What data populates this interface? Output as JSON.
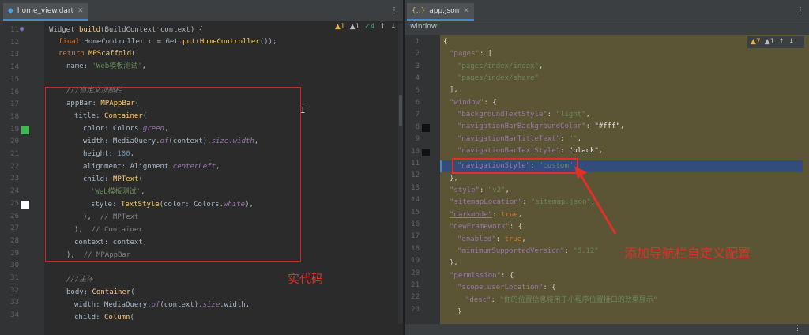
{
  "left": {
    "tab": "home_view.dart",
    "inspection": {
      "warn": "1",
      "weak": "1",
      "typo": "4"
    },
    "lines": [
      "11",
      "12",
      "13",
      "14",
      "15",
      "16",
      "17",
      "18",
      "19",
      "20",
      "21",
      "22",
      "23",
      "24",
      "25",
      "26",
      "27",
      "28",
      "29",
      "30",
      "31",
      "32",
      "33",
      "34"
    ],
    "code": {
      "l11a": "Widget ",
      "l11b": "build",
      "l11c": "(BuildContext context) {",
      "l12a": "final ",
      "l12b": "HomeController c = Get.",
      "l12c": "put",
      "l12d": "(",
      "l12e": "HomeController",
      "l12f": "());",
      "l13a": "return ",
      "l13b": "MPScaffold",
      "l13c": "(",
      "l14a": "name: ",
      "l14b": "'Web模板测试'",
      "l14c": ",",
      "l16": "///自定义顶部栏",
      "l17a": "appBar: ",
      "l17b": "MPAppBar",
      "l17c": "(",
      "l18a": "title: ",
      "l18b": "Container",
      "l18c": "(",
      "l19a": "color: Colors.",
      "l19b": "green",
      "l19c": ",",
      "l20a": "width: MediaQuery.",
      "l20b": "of",
      "l20c": "(context).",
      "l20d": "size",
      "l20e": ".",
      "l20f": "width",
      "l20g": ",",
      "l21a": "height: ",
      "l21b": "100",
      "l21c": ",",
      "l22a": "alignment: Alignment.",
      "l22b": "centerLeft",
      "l22c": ",",
      "l23a": "child: ",
      "l23b": "MPText",
      "l23c": "(",
      "l24a": "'Web模板测试'",
      "l24b": ",",
      "l25a": "style: ",
      "l25b": "TextStyle",
      "l25c": "(color: Colors.",
      "l25d": "white",
      "l25e": "),",
      "l26a": "),  ",
      "l26b": "// MPText",
      "l27a": "),  ",
      "l27b": "// Container",
      "l28": "context: context,",
      "l29a": "),  ",
      "l29b": "// MPAppBar",
      "l31": "///主体",
      "l32a": "body: ",
      "l32b": "Container",
      "l32c": "(",
      "l33a": "width: MediaQuery.",
      "l33b": "of",
      "l33c": "(context).",
      "l33d": "size",
      "l33e": ".width,",
      "l34a": "child: ",
      "l34b": "Column",
      "l34c": "("
    },
    "annotation": "实代码"
  },
  "right": {
    "tab": "app.json",
    "tool_window": "window",
    "inspection": {
      "warn": "7",
      "weak": "1"
    },
    "lines": [
      "1",
      "2",
      "3",
      "4",
      "5",
      "6",
      "7",
      "8",
      "9",
      "10",
      "11",
      "12",
      "13",
      "14",
      "15",
      "16",
      "17",
      "18",
      "19",
      "20",
      "21",
      "22",
      "23"
    ],
    "json": {
      "j1": "{",
      "j2a": "\"pages\"",
      "j2b": ": [",
      "j3": "\"pages/index/index\"",
      "j3b": ",",
      "j4": "\"pages/index/share\"",
      "j5": "],",
      "j6a": "\"window\"",
      "j6b": ": {",
      "j7a": "\"backgroundTextStyle\"",
      "j7b": ": ",
      "j7c": "\"light\"",
      "j7d": ",",
      "j8a": "\"navigationBarBackgroundColor\"",
      "j8b": ": ",
      "j8c": "\"#fff\"",
      "j8d": ",",
      "j9a": "\"navigationBarTitleText\"",
      "j9b": ": ",
      "j9c": "\"\"",
      "j9d": ",",
      "j10a": "\"navigationBarTextStyle\"",
      "j10b": ": ",
      "j10c": "\"black\"",
      "j10d": ",",
      "j11a": "\"navigationStyle\"",
      "j11b": ": ",
      "j11c": "\"custom\"",
      "j12": "},",
      "j13a": "\"style\"",
      "j13b": ": ",
      "j13c": "\"v2\"",
      "j13d": ",",
      "j14a": "\"sitemapLocation\"",
      "j14b": ": ",
      "j14c": "\"sitemap.json\"",
      "j14d": ",",
      "j15a": "\"darkmode\"",
      "j15b": ": ",
      "j15c": "true",
      "j15d": ",",
      "j16a": "\"newFramework\"",
      "j16b": ": {",
      "j17a": "\"enabled\"",
      "j17b": ": ",
      "j17c": "true",
      "j17d": ",",
      "j18a": "\"minimumSupportedVersion\"",
      "j18b": ": ",
      "j18c": "\"5.12\"",
      "j19": "},",
      "j20a": "\"permission\"",
      "j20b": ": {",
      "j21a": "\"scope.userLocation\"",
      "j21b": ": {",
      "j22a": "\"desc\"",
      "j22b": ": ",
      "j22c": "\"你的位置信息将用于小程序位置接口的效果展示\"",
      "j23": "}"
    },
    "annotation": "添加导航栏自定义配置"
  },
  "colors": {
    "green_swatch": "#3fb950",
    "white_swatch": "#ffffff",
    "black_swatch": "#111111",
    "annot_red": "#e0302a"
  }
}
